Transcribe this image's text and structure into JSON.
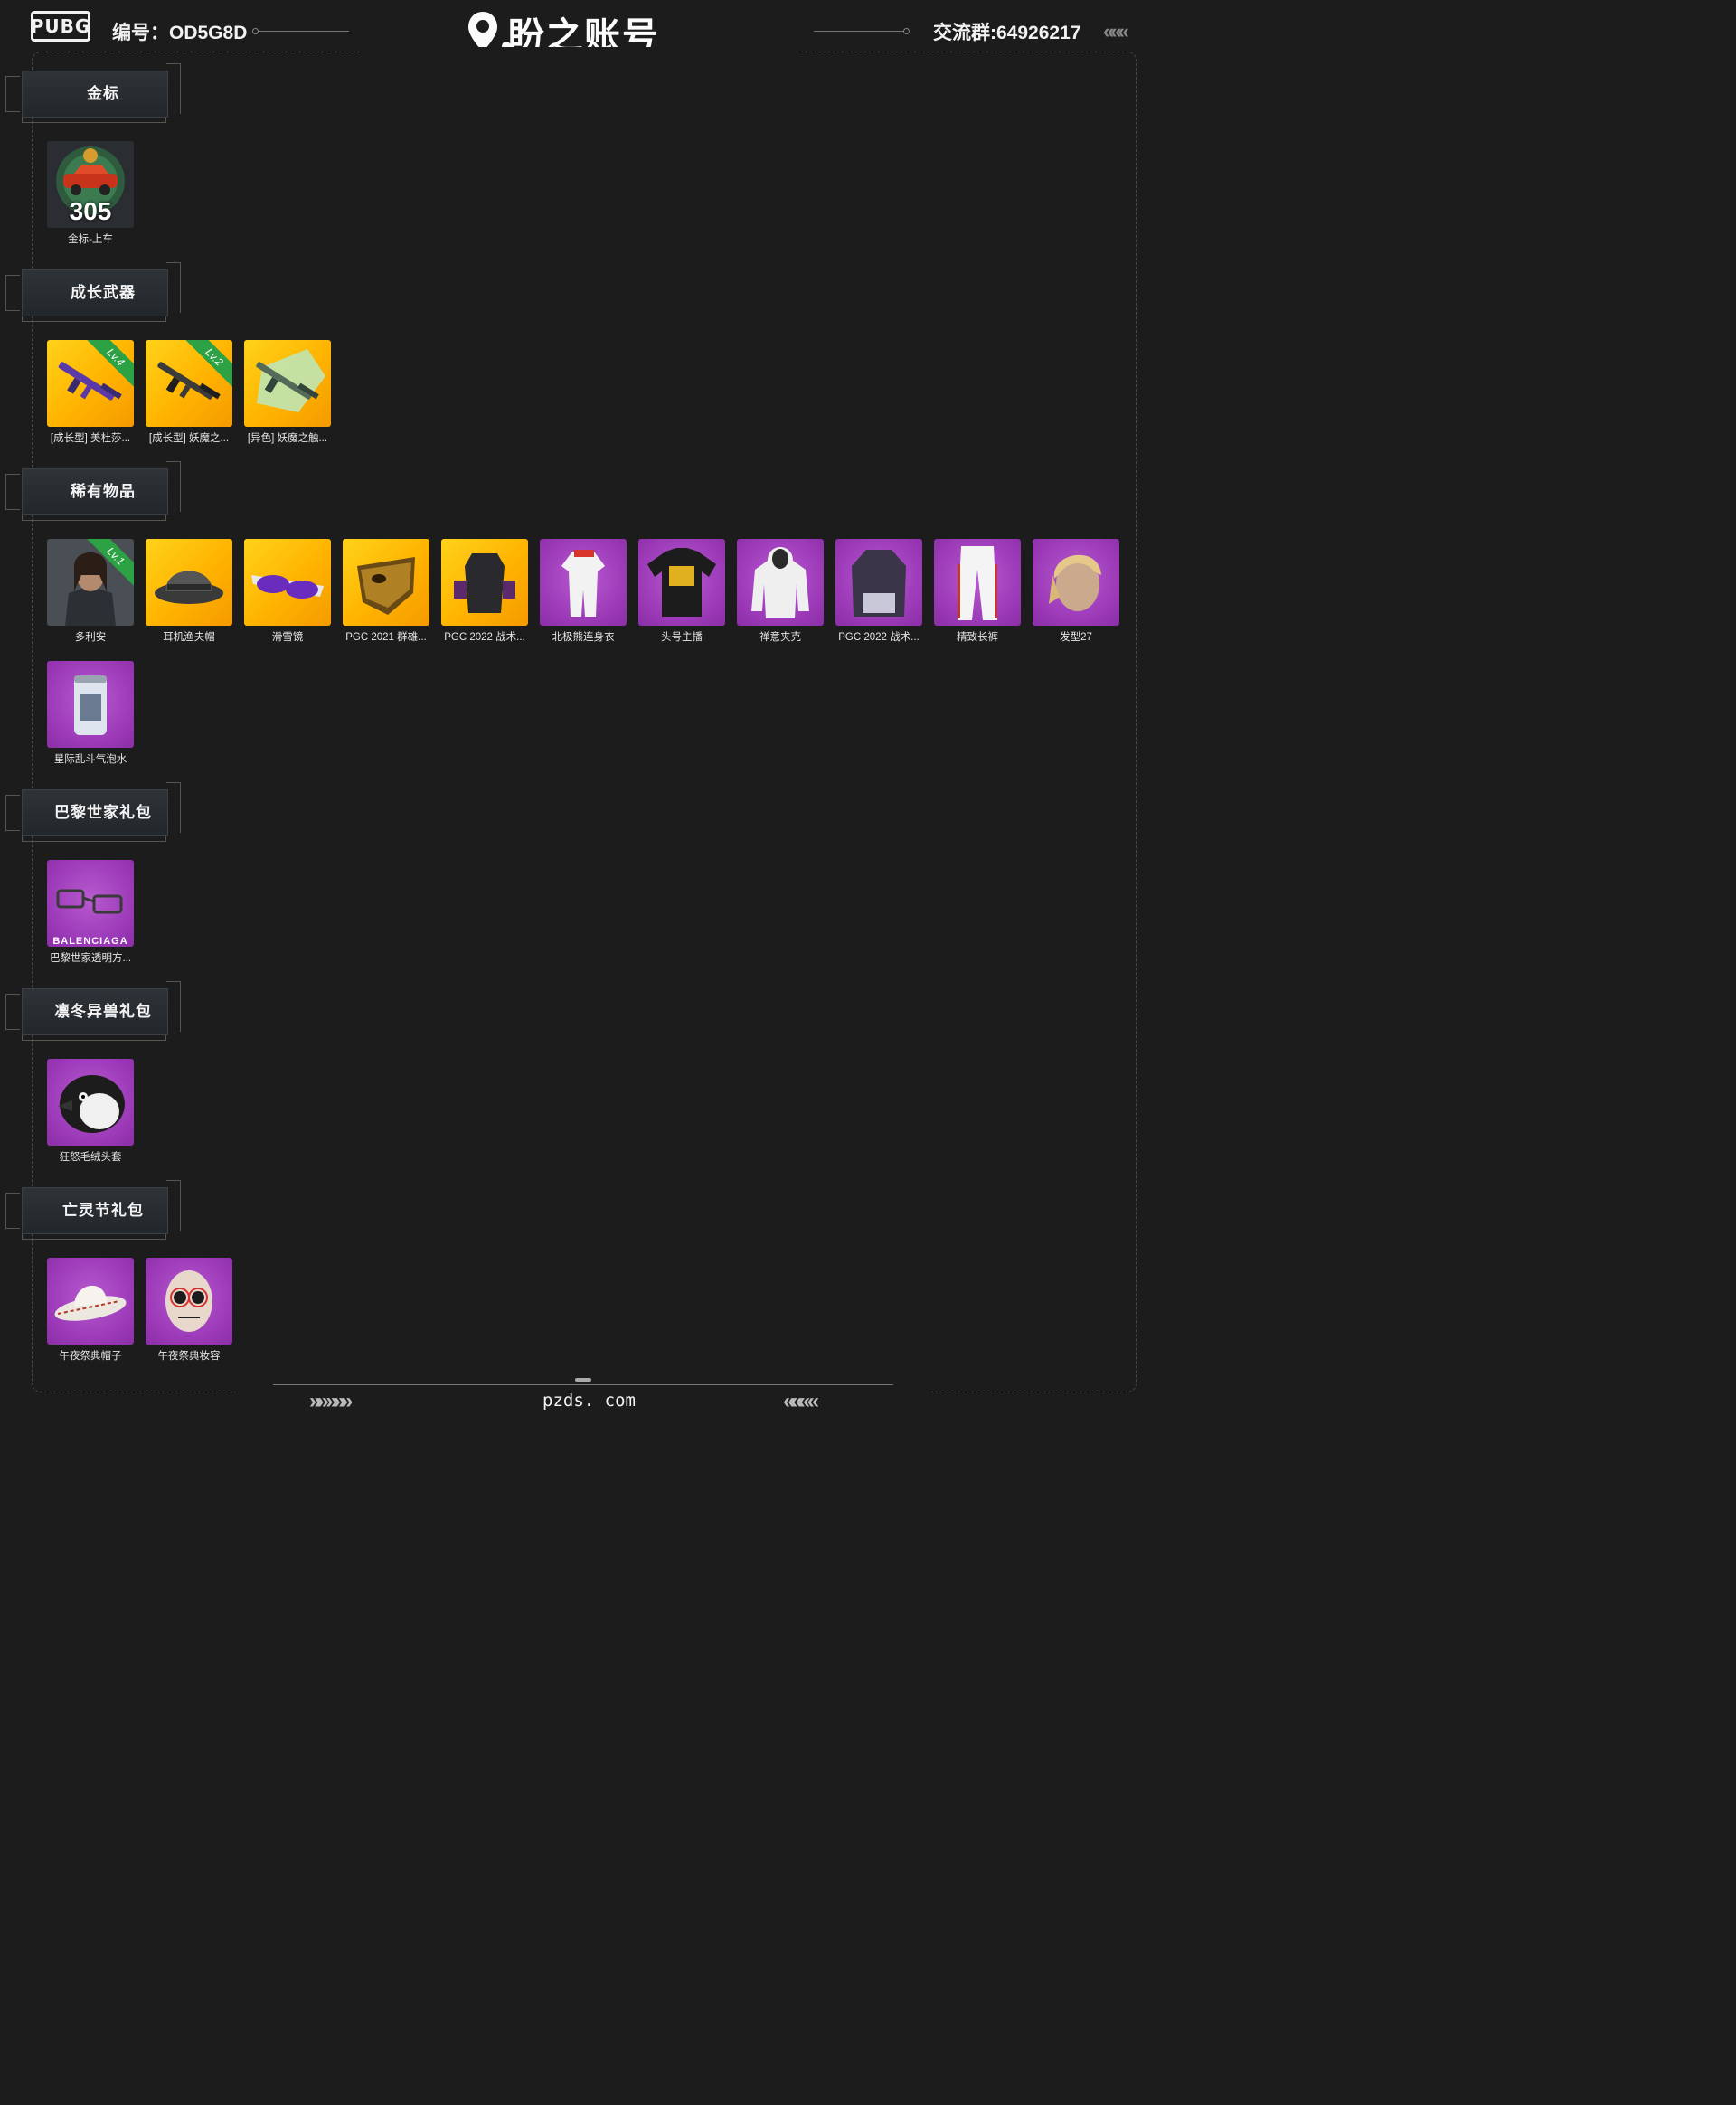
{
  "header": {
    "logo": "PUBG",
    "serial": "编号：OD5G8D",
    "brand": "盼之账号",
    "group": "交流群:64926217",
    "chevrons": "«««"
  },
  "sections": [
    {
      "title": "金标",
      "items": [
        {
          "label": "金标-上车",
          "badge": "305",
          "icon": "gold-badge-car-icon"
        }
      ]
    },
    {
      "title": "成长武器",
      "items": [
        {
          "label": "[成长型] 美杜莎...",
          "level": "Lv.4",
          "icon": "rifle-icon"
        },
        {
          "label": "[成长型] 妖魔之...",
          "level": "Lv.2",
          "icon": "rifle-icon"
        },
        {
          "label": "[异色] 妖魔之触...",
          "icon": "rifle-icon"
        }
      ]
    },
    {
      "title": "稀有物品",
      "items": [
        {
          "label": "多利安",
          "level": "Lv.1",
          "icon": "character-portrait-icon"
        },
        {
          "label": "耳机渔夫帽",
          "icon": "bucket-hat-icon"
        },
        {
          "label": "滑雪镜",
          "icon": "goggles-icon"
        },
        {
          "label": "PGC 2021 群雄...",
          "icon": "mask-icon"
        },
        {
          "label": "PGC 2022 战术...",
          "icon": "vest-icon"
        },
        {
          "label": "北极熊连身衣",
          "icon": "jumpsuit-icon"
        },
        {
          "label": "头号主播",
          "icon": "tshirt-icon"
        },
        {
          "label": "禅意夹克",
          "icon": "hoodie-icon"
        },
        {
          "label": "PGC 2022 战术...",
          "icon": "jacket-icon"
        },
        {
          "label": "精致长裤",
          "icon": "pants-icon"
        },
        {
          "label": "发型27",
          "icon": "hairstyle-icon"
        },
        {
          "label": "星际乱斗气泡水",
          "icon": "soda-can-icon"
        }
      ]
    },
    {
      "title": "巴黎世家礼包",
      "items": [
        {
          "label": "巴黎世家透明方...",
          "caption": "BALENCIAGA",
          "icon": "glasses-icon"
        }
      ]
    },
    {
      "title": "凛冬异兽礼包",
      "items": [
        {
          "label": "狂怒毛绒头套",
          "icon": "penguin-head-icon"
        }
      ]
    },
    {
      "title": "亡灵节礼包",
      "items": [
        {
          "label": "午夜祭典帽子",
          "icon": "cowboy-hat-icon"
        },
        {
          "label": "午夜祭典妆容",
          "icon": "skull-face-icon"
        }
      ]
    }
  ],
  "footer": {
    "site": "pzds. com"
  },
  "colors": {
    "background": "#1c1c1d",
    "gold_tile": "#ffc107",
    "purple_tile": "#9a38b6",
    "level_ribbon": "#2ca244"
  }
}
